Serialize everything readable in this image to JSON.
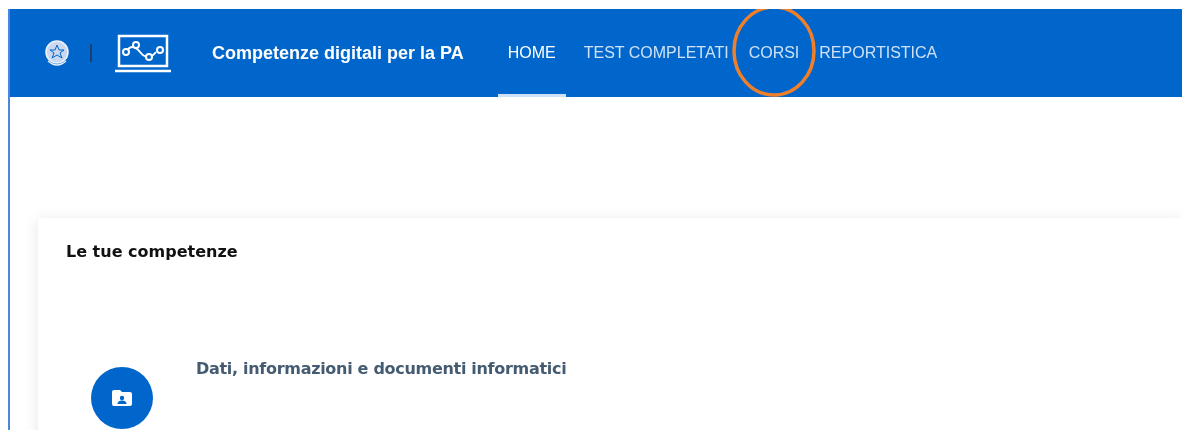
{
  "header": {
    "title": "Competenze digitali per la PA",
    "nav": [
      {
        "label": "HOME",
        "selected": true,
        "circled": false
      },
      {
        "label": "TEST COMPLETATI",
        "selected": false,
        "circled": false
      },
      {
        "label": "CORSI",
        "selected": false,
        "circled": true
      },
      {
        "label": "REPORTISTICA",
        "selected": false,
        "circled": false
      }
    ]
  },
  "card": {
    "title": "Le tue competenze",
    "areas": [
      {
        "label": "Dati, informazioni e documenti informatici"
      }
    ]
  }
}
